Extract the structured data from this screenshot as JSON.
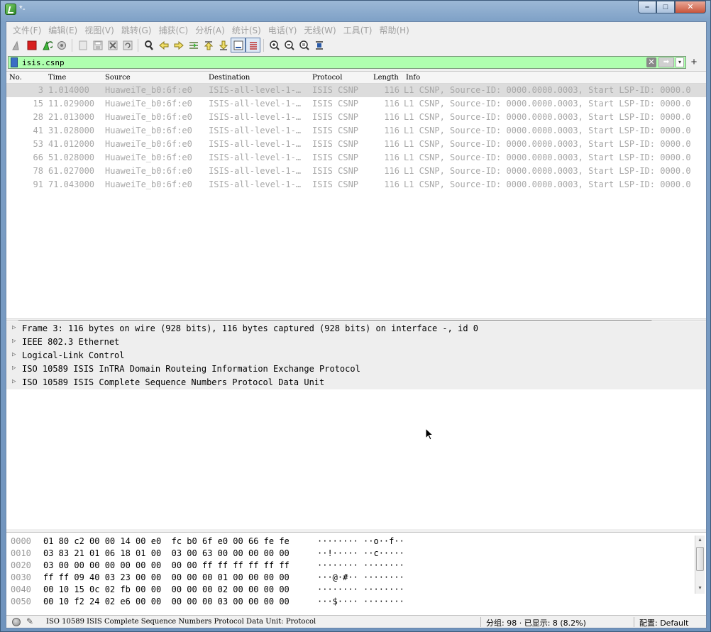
{
  "window": {
    "title": "*-",
    "btn_min": "–",
    "btn_max": "□",
    "btn_close": "✕"
  },
  "menu": [
    "文件(F)",
    "编辑(E)",
    "视图(V)",
    "跳转(G)",
    "捕获(C)",
    "分析(A)",
    "统计(S)",
    "电话(Y)",
    "无线(W)",
    "工具(T)",
    "帮助(H)"
  ],
  "toolbar": {
    "icons": [
      "shark-fin-start-icon",
      "stop-capture-icon",
      "restart-capture-icon",
      "capture-options-icon",
      "open-file-icon",
      "save-file-icon",
      "close-file-icon",
      "reload-file-icon",
      "find-packet-icon",
      "go-back-icon",
      "go-forward-icon",
      "go-to-packet-icon",
      "go-first-icon",
      "go-last-icon",
      "autoscroll-icon",
      "colorize-icon",
      "zoom-in-icon",
      "zoom-out-icon",
      "zoom-normal-icon",
      "resize-columns-icon"
    ]
  },
  "filter": {
    "value": "isis.csnp",
    "clear": "✕",
    "apply": "➡",
    "dropdown": "▾",
    "plus": "+"
  },
  "packet_list": {
    "columns": {
      "no": "No.",
      "time": "Time",
      "source": "Source",
      "destination": "Destination",
      "protocol": "Protocol",
      "length": "Length",
      "info": "Info"
    },
    "rows": [
      {
        "no": "3",
        "time": "1.014000",
        "source": "HuaweiTe_b0:6f:e0",
        "destination": "ISIS-all-level-1-…",
        "protocol": "ISIS CSNP",
        "length": "116",
        "info": "L1 CSNP, Source-ID: 0000.0000.0003, Start LSP-ID: 0000.0"
      },
      {
        "no": "15",
        "time": "11.029000",
        "source": "HuaweiTe_b0:6f:e0",
        "destination": "ISIS-all-level-1-…",
        "protocol": "ISIS CSNP",
        "length": "116",
        "info": "L1 CSNP, Source-ID: 0000.0000.0003, Start LSP-ID: 0000.0"
      },
      {
        "no": "28",
        "time": "21.013000",
        "source": "HuaweiTe_b0:6f:e0",
        "destination": "ISIS-all-level-1-…",
        "protocol": "ISIS CSNP",
        "length": "116",
        "info": "L1 CSNP, Source-ID: 0000.0000.0003, Start LSP-ID: 0000.0"
      },
      {
        "no": "41",
        "time": "31.028000",
        "source": "HuaweiTe_b0:6f:e0",
        "destination": "ISIS-all-level-1-…",
        "protocol": "ISIS CSNP",
        "length": "116",
        "info": "L1 CSNP, Source-ID: 0000.0000.0003, Start LSP-ID: 0000.0"
      },
      {
        "no": "53",
        "time": "41.012000",
        "source": "HuaweiTe_b0:6f:e0",
        "destination": "ISIS-all-level-1-…",
        "protocol": "ISIS CSNP",
        "length": "116",
        "info": "L1 CSNP, Source-ID: 0000.0000.0003, Start LSP-ID: 0000.0"
      },
      {
        "no": "66",
        "time": "51.028000",
        "source": "HuaweiTe_b0:6f:e0",
        "destination": "ISIS-all-level-1-…",
        "protocol": "ISIS CSNP",
        "length": "116",
        "info": "L1 CSNP, Source-ID: 0000.0000.0003, Start LSP-ID: 0000.0"
      },
      {
        "no": "78",
        "time": "61.027000",
        "source": "HuaweiTe_b0:6f:e0",
        "destination": "ISIS-all-level-1-…",
        "protocol": "ISIS CSNP",
        "length": "116",
        "info": "L1 CSNP, Source-ID: 0000.0000.0003, Start LSP-ID: 0000.0"
      },
      {
        "no": "91",
        "time": "71.043000",
        "source": "HuaweiTe_b0:6f:e0",
        "destination": "ISIS-all-level-1-…",
        "protocol": "ISIS CSNP",
        "length": "116",
        "info": "L1 CSNP, Source-ID: 0000.0000.0003, Start LSP-ID: 0000.0"
      }
    ]
  },
  "hscroll": {
    "left": "◂",
    "right": "▸",
    "grip": "|||"
  },
  "details": {
    "arrow": "▷",
    "rows": [
      "Frame 3: 116 bytes on wire (928 bits), 116 bytes captured (928 bits) on interface -, id 0",
      "IEEE 802.3 Ethernet",
      "Logical-Link Control",
      "ISO 10589 ISIS InTRA Domain Routeing Information Exchange Protocol",
      "ISO 10589 ISIS Complete Sequence Numbers Protocol Data Unit"
    ]
  },
  "bytes": {
    "rows": [
      {
        "offset": "0000",
        "hex": "01 80 c2 00 00 14 00 e0  fc b0 6f e0 00 66 fe fe",
        "ascii": "········ ··o··f··"
      },
      {
        "offset": "0010",
        "hex": "03 83 21 01 06 18 01 00  03 00 63 00 00 00 00 00",
        "ascii": "··!····· ··c·····"
      },
      {
        "offset": "0020",
        "hex": "03 00 00 00 00 00 00 00  00 00 ff ff ff ff ff ff",
        "ascii": "········ ········"
      },
      {
        "offset": "0030",
        "hex": "ff ff 09 40 03 23 00 00  00 00 00 01 00 00 00 00",
        "ascii": "···@·#·· ········"
      },
      {
        "offset": "0040",
        "hex": "00 10 15 0c 02 fb 00 00  00 00 00 02 00 00 00 00",
        "ascii": "········ ········"
      },
      {
        "offset": "0050",
        "hex": "00 10 f2 24 02 e6 00 00  00 00 00 03 00 00 00 00",
        "ascii": "···$···· ········"
      }
    ],
    "scroll_up": "▴",
    "scroll_down": "▾"
  },
  "status": {
    "edit_icon": "✎",
    "text": "ISO 10589 ISIS Complete Sequence Numbers Protocol Data Unit: Protocol",
    "packets": "分组: 98 · 已显示: 8 (8.2%)",
    "profile": "配置: Default"
  },
  "colors": {
    "filter_bg": "#afffaf",
    "selected_row": "#dcdcdc",
    "stop_red": "#d81e1e",
    "title_blue": "#7ea0c6"
  }
}
